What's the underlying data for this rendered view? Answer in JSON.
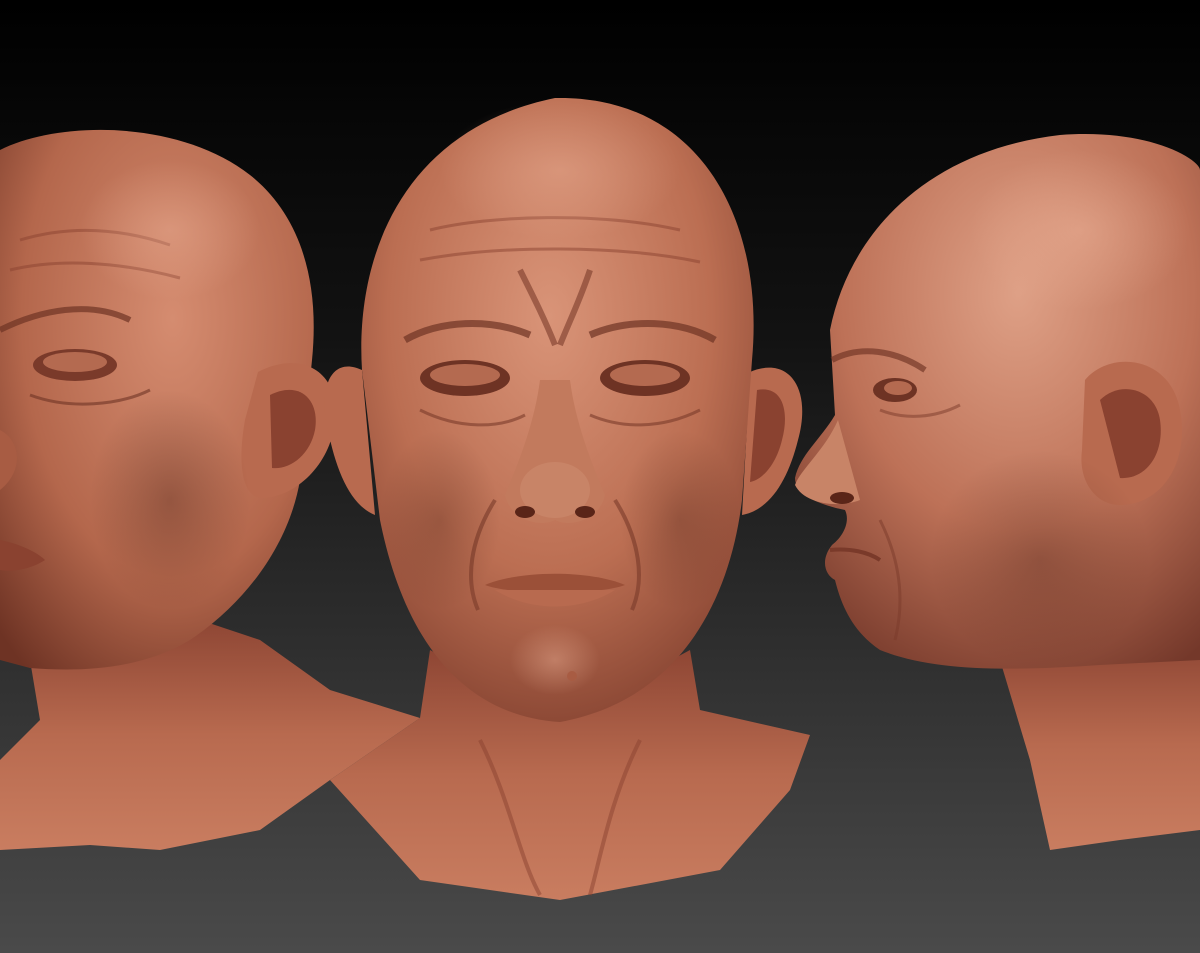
{
  "scene": {
    "background_top": "#000000",
    "background_bottom": "#4a4a4a",
    "clay_light": "#d98f73",
    "clay_mid": "#b86a4f",
    "clay_dark": "#6e3324",
    "views": [
      {
        "id": "three-quarter-left",
        "icon": "sculpt-head-icon"
      },
      {
        "id": "front",
        "icon": "sculpt-head-icon"
      },
      {
        "id": "profile-right",
        "icon": "sculpt-head-icon"
      }
    ]
  }
}
